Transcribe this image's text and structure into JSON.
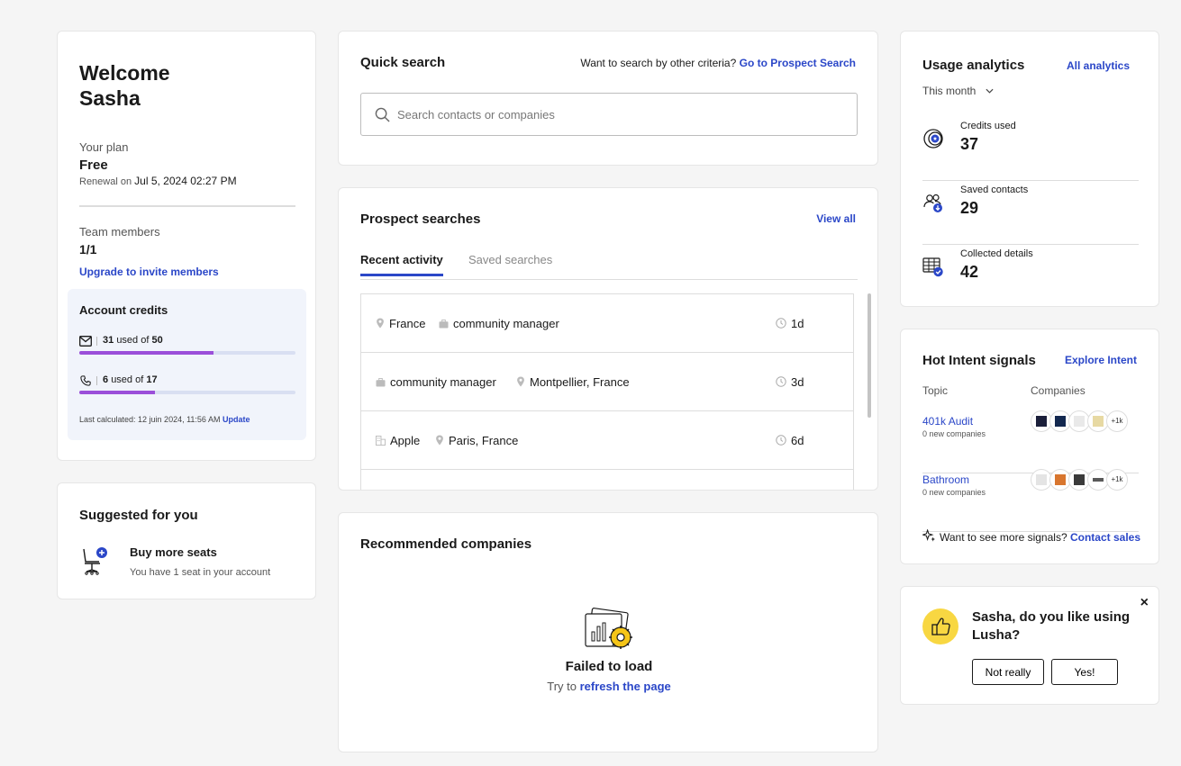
{
  "welcome": {
    "greeting": "Welcome",
    "name": "Sasha",
    "plan_label": "Your plan",
    "plan_value": "Free",
    "renewal_label": "Renewal on",
    "renewal_date": "Jul 5, 2024 02:27 PM",
    "team_label": "Team members",
    "team_value": "1/1",
    "upgrade_link": "Upgrade to invite members",
    "credits": {
      "title": "Account credits",
      "email": {
        "used": "31",
        "of": "used of",
        "total": "50",
        "progress": 0.62,
        "icon": "mail-icon"
      },
      "phone": {
        "used": "6",
        "of": "used of",
        "total": "17",
        "progress": 0.35,
        "icon": "phone-icon"
      },
      "calc_label": "Last calculated: 12 juin 2024, 11:56 AM",
      "update_link": "Update"
    }
  },
  "suggested": {
    "title": "Suggested for you",
    "item_title": "Buy more seats",
    "item_sub": "You have 1 seat in your account",
    "icon": "office-chair-plus-icon"
  },
  "quick_search": {
    "title": "Quick search",
    "criteria_text": "Want to search by other criteria?",
    "criteria_link": "Go to Prospect Search",
    "placeholder": "Search contacts or companies"
  },
  "prospect": {
    "title": "Prospect searches",
    "view_all": "View all",
    "tabs": [
      "Recent activity",
      "Saved searches"
    ],
    "rows": [
      {
        "chip1": "France",
        "chip1_icon": "location-pin-icon",
        "chip2": "community manager",
        "chip2_icon": "briefcase-icon",
        "time": "1d"
      },
      {
        "chip1": "community manager",
        "chip1_icon": "briefcase-icon",
        "chip2": "Montpellier, France",
        "chip2_icon": "location-pin-icon",
        "time": "3d"
      },
      {
        "chip1": "Apple",
        "chip1_icon": "building-icon",
        "chip2": "Paris, France",
        "chip2_icon": "location-pin-icon",
        "time": "6d"
      }
    ]
  },
  "recommended": {
    "title": "Recommended companies",
    "failed": "Failed to load",
    "try_text": "Try to",
    "refresh_link": "refresh the page"
  },
  "usage": {
    "title": "Usage analytics",
    "all_link": "All analytics",
    "period": "This month",
    "stats": [
      {
        "label": "Credits used",
        "value": "37",
        "icon": "credits-icon"
      },
      {
        "label": "Saved contacts",
        "value": "29",
        "icon": "saved-contacts-icon"
      },
      {
        "label": "Collected details",
        "value": "42",
        "icon": "collected-details-icon"
      }
    ]
  },
  "intent": {
    "title": "Hot Intent signals",
    "explore_link": "Explore Intent",
    "col_topic": "Topic",
    "col_companies": "Companies",
    "rows": [
      {
        "topic": "401k Audit",
        "sub": "0 new companies",
        "more": "+1k"
      },
      {
        "topic": "Bathroom",
        "sub": "0 new companies",
        "more": "+1k"
      }
    ],
    "signals_text": "Want to see more signals?",
    "signals_link": "Contact sales"
  },
  "feedback": {
    "question": "Sasha, do you like using Lusha?",
    "no_label": "Not really",
    "yes_label": "Yes!",
    "close": "×"
  },
  "colors": {
    "accent": "#2b47c8",
    "progress": "#9b4fd9",
    "credits_bg": "#f1f4fb",
    "thumb": "#f8d742"
  }
}
